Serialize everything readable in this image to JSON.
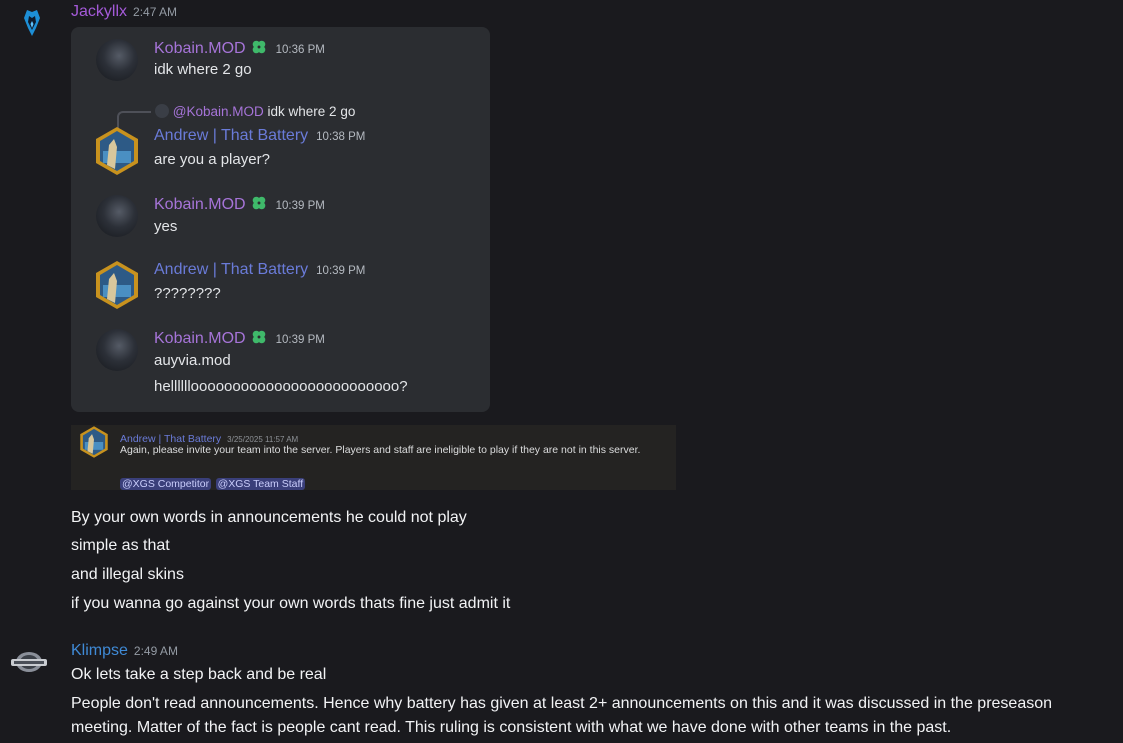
{
  "colors": {
    "background": "#1a1a1e",
    "card": "#2b2d31",
    "username_jackyllx": "#a45ad8",
    "username_klimpse": "#3f8ad6",
    "kobain": "#a674d8",
    "andrew": "#6a7bd8",
    "badge": "#3fb96a"
  },
  "icons": {
    "badge": "clover-badge-icon",
    "jackyllx_avatar": "blue-wings-logo",
    "klimpse_avatar": "klimpse-logo"
  },
  "messages": [
    {
      "author": "Jackyllx",
      "time": "2:47 AM",
      "embedded_chat": {
        "items": [
          {
            "author": "Kobain.MOD",
            "time": "10:36 PM",
            "lines": [
              "idk where 2 go"
            ]
          },
          {
            "reply_to": "@Kobain.MOD",
            "reply_text": "idk where 2 go",
            "author": "Andrew | That Battery",
            "time": "10:38 PM",
            "lines": [
              "are you a player?"
            ]
          },
          {
            "author": "Kobain.MOD",
            "time": "10:39 PM",
            "lines": [
              "yes"
            ]
          },
          {
            "author": "Andrew | That Battery",
            "time": "10:39 PM",
            "lines": [
              "????????"
            ]
          },
          {
            "author": "Kobain.MOD",
            "time": "10:39 PM",
            "lines": [
              "auyvia.mod",
              "hellllllooooooooooooooooooooooooo?"
            ]
          }
        ]
      },
      "announcement": {
        "author": "Andrew | That Battery",
        "time": "3/25/2025 11:57 AM",
        "text": "Again, please invite your team into the server. Players and staff are ineligible to play if they are not in this server.",
        "mentions": [
          "@XGS Competitor",
          "@XGS Team Staff"
        ]
      },
      "lines": [
        "By your own words in announcements he could not play",
        "simple as that",
        "and illegal skins",
        "if you wanna go against your own words thats fine just admit it"
      ]
    },
    {
      "author": "Klimpse",
      "time": "2:49 AM",
      "lines": [
        "Ok lets take a step back and be real",
        "People don't read announcements.  Hence why battery has given at least 2+ announcements on this and it was discussed in the preseason",
        "meeting.  Matter of the fact is people cant read.  This ruling is consistent with what we have done with other teams in the past."
      ]
    }
  ]
}
